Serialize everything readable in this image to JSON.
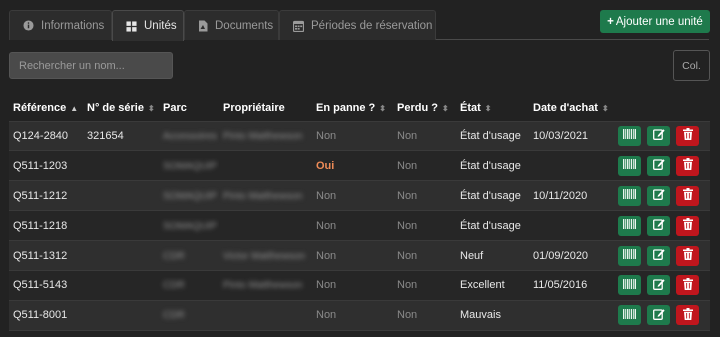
{
  "tabs": [
    {
      "label": "Informations",
      "icon": "info-icon",
      "active": false
    },
    {
      "label": "Unités",
      "icon": "grid-icon",
      "active": true
    },
    {
      "label": "Documents",
      "icon": "document-icon",
      "active": false
    },
    {
      "label": "Périodes de réservation",
      "icon": "calendar-icon",
      "active": false
    }
  ],
  "toolbar": {
    "add_label": "Ajouter une unité",
    "add_icon": "plus-icon",
    "columns_label": "Col."
  },
  "search": {
    "placeholder": "Rechercher un nom...",
    "value": ""
  },
  "table": {
    "columns": [
      "Référence",
      "N° de série",
      "Parc",
      "Propriétaire",
      "En panne ?",
      "Perdu ?",
      "État",
      "Date d'achat"
    ],
    "sorted_column": "Référence",
    "rows": [
      {
        "reference": "Q124-2840",
        "serial": "321654",
        "park": "Accessoires",
        "owner": "Pinto Matthewson",
        "broken": "Non",
        "lost": "Non",
        "state": "État d'usage",
        "date": "10/03/2021"
      },
      {
        "reference": "Q511-1203",
        "serial": "",
        "park": "SOMAQUIP",
        "owner": "",
        "broken": "Oui",
        "lost": "Non",
        "state": "État d'usage",
        "date": ""
      },
      {
        "reference": "Q511-1212",
        "serial": "",
        "park": "SOMAQUIP",
        "owner": "Pinto Matthewson",
        "broken": "Non",
        "lost": "Non",
        "state": "État d'usage",
        "date": "10/11/2020"
      },
      {
        "reference": "Q511-1218",
        "serial": "",
        "park": "SOMAQUIP",
        "owner": "",
        "broken": "Non",
        "lost": "Non",
        "state": "État d'usage",
        "date": ""
      },
      {
        "reference": "Q511-1312",
        "serial": "",
        "park": "CDR",
        "owner": "Victor Matthewson",
        "broken": "Non",
        "lost": "Non",
        "state": "Neuf",
        "date": "01/09/2020"
      },
      {
        "reference": "Q511-5143",
        "serial": "",
        "park": "CDR",
        "owner": "Pinto Matthewson",
        "broken": "Non",
        "lost": "Non",
        "state": "Excellent",
        "date": "11/05/2016"
      },
      {
        "reference": "Q511-8001",
        "serial": "",
        "park": "CDR",
        "owner": "",
        "broken": "Non",
        "lost": "Non",
        "state": "Mauvais",
        "date": ""
      }
    ],
    "row_actions": [
      "barcode-icon",
      "edit-icon",
      "trash-icon"
    ]
  },
  "colors": {
    "background": "#222222",
    "accent_green": "#1e7a4c",
    "danger_red": "#c0161d",
    "oui_orange": "#ee8b57"
  }
}
